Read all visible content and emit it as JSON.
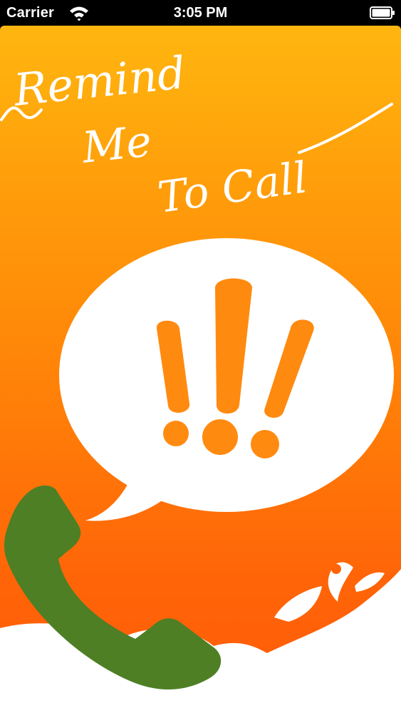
{
  "status_bar": {
    "carrier": "Carrier",
    "time": "3:05 PM",
    "wifi_icon": "wifi-icon",
    "battery_icon": "battery-icon"
  },
  "splash": {
    "title_line_1": "Remind",
    "title_line_2": "Me",
    "title_line_3": "To Call",
    "speech_bubble_icon": "speech-bubble-icon",
    "exclamation_icon": "triple-exclamation-icon",
    "phone_icon": "phone-handset-icon",
    "splash_icon": "water-splash-icon"
  },
  "colors": {
    "gradient_top": "#ffb60f",
    "gradient_bottom": "#ff5a08",
    "phone_green": "#4e7f25",
    "accent_orange": "#ff8a10",
    "white": "#ffffff"
  }
}
